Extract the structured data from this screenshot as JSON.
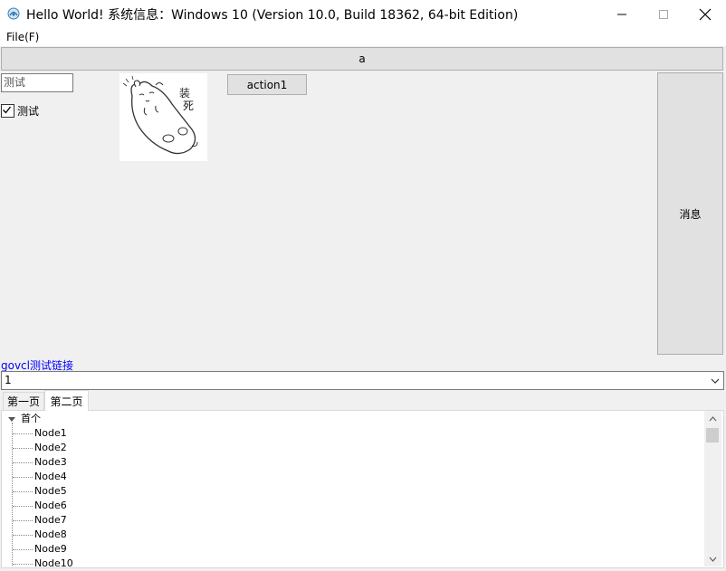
{
  "window": {
    "title": "Hello World! 系统信息：Windows 10 (Version 10.0, Build 18362, 64-bit Edition)",
    "controls": {
      "minimize": "minimize-icon",
      "maximize": "maximize-icon",
      "close": "close-icon"
    }
  },
  "menu": {
    "file": "File(F)"
  },
  "toolbar": {
    "a_label": "a"
  },
  "left": {
    "edit_value": "测试",
    "checkbox_label": "测试",
    "checkbox_checked": true
  },
  "buttons": {
    "action1": "action1",
    "message": "消息"
  },
  "image": {
    "caption_chars": "装死"
  },
  "link": {
    "text": "govcl测试链接"
  },
  "combo": {
    "value": "1"
  },
  "tabs": [
    {
      "label": "第一页"
    },
    {
      "label": "第二页",
      "active": true
    }
  ],
  "tree": {
    "root": "首个",
    "nodes": [
      "Node1",
      "Node2",
      "Node3",
      "Node4",
      "Node5",
      "Node6",
      "Node7",
      "Node8",
      "Node9",
      "Node10"
    ]
  },
  "colors": {
    "link": "#0000ff",
    "button_face": "#e1e1e1",
    "window_bg": "#f0f0f0"
  }
}
